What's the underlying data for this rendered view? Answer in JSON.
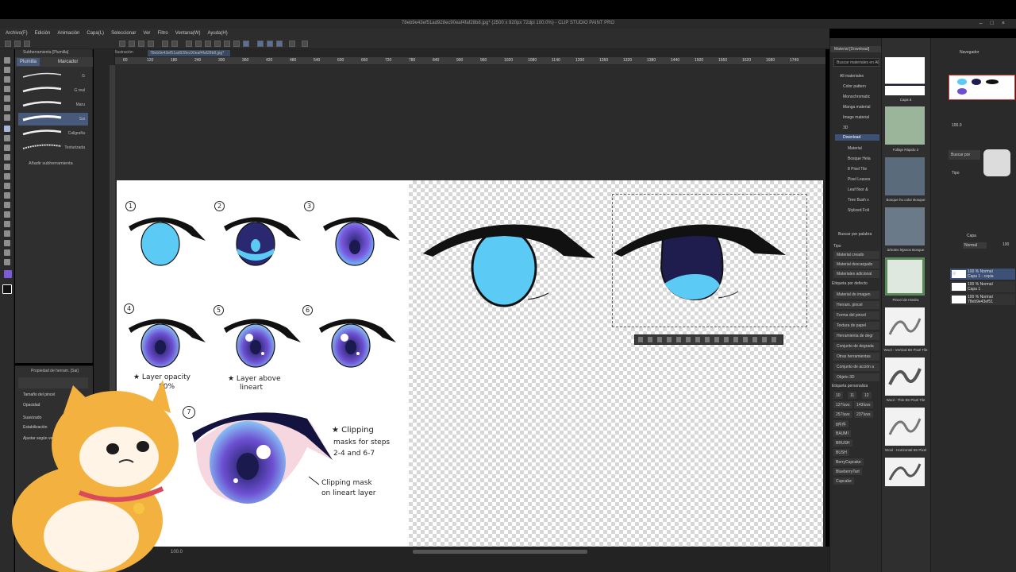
{
  "window": {
    "title": "78eb9e43ef51ad928ec90eaf4faf28b8.jpg* (2500 x 920px 72dpi 100.0%) - CLIP STUDIO PAINT PRO"
  },
  "menu": [
    "Archivo(F)",
    "Edición",
    "Animación",
    "Capa(L)",
    "Seleccionar",
    "Ver",
    "Filtro",
    "Ventana(W)",
    "Ayuda(H)"
  ],
  "canvas_tabs": {
    "left_label": "Ilustración",
    "file_tab": "78eb9e43ef51ad928ec90eaf4faf28b8.jpg*"
  },
  "ruler_ticks": [
    "60",
    "120",
    "180",
    "240",
    "300",
    "360",
    "420",
    "480",
    "540",
    "600",
    "660",
    "720",
    "780",
    "840",
    "900",
    "960",
    "1020",
    "1080",
    "1140",
    "1200",
    "1260",
    "1320",
    "1380",
    "1440",
    "1500",
    "1560",
    "1620",
    "1680",
    "1749"
  ],
  "subtool": {
    "header": "Subherramienta [Plumilla]",
    "tabs": [
      "Plumilla",
      "Marcador"
    ],
    "brushes": [
      "G",
      "G real",
      "Maru",
      "Sai",
      "Caligrafía",
      "Texturizada"
    ],
    "selected": "Sai",
    "add_label": "Añadir subherramienta"
  },
  "tool_property": {
    "header": "Propiedad de herram. [Sai]",
    "fields": [
      "Tamaño del pincel",
      "Opacidad",
      "Suavizado",
      "Estabilización",
      "Ajustar según vel."
    ]
  },
  "material_panel": {
    "header": "Material [Download]",
    "search_placeholder": "Buscar materiales en All",
    "tree": [
      "All materiales",
      "Color pattern",
      "Monochromatic",
      "Manga material",
      "Image material",
      "3D",
      "Download",
      "Material",
      "Bosque Hela",
      "8 Pixel Tile",
      "Pixel Leaves",
      "Leaf floor &",
      "Tree Bush s",
      "Stylized Foli"
    ],
    "selected_tree": "Download",
    "search_label": "Buscar por palabra",
    "type_label": "Tipo",
    "type_items": [
      "Material creado",
      "Material descargado",
      "Materiales adicional"
    ],
    "default_tag_label": "Etiqueta por defecto",
    "default_tags": [
      "Material de imagen",
      "Herram. pincel",
      "Forma del pincel",
      "Textura de papel",
      "Herramienta de degr",
      "Conjunto de degrada",
      "Otras herramientas",
      "Conjunto de acción a",
      "Objeto 3D"
    ],
    "custom_tag_label": "Etiqueta personaliza",
    "custom_tags": [
      "10",
      "11",
      "12",
      "127Iuvs",
      "143Iuvs",
      "257Iuvs",
      "237Iuvs",
      "8件件",
      "BAUMI",
      "BRUSH",
      "BUSH",
      "BerryCupcake",
      "BlueberryTart",
      "Cupcake"
    ]
  },
  "material_thumbs": [
    "Capa 6",
    "Follaje Rápido 2",
    "Bosque hu color Bosque",
    "árboles lejanos Bosque",
    "Pincel de Hiedra",
    "Wool - Vertical 8S Pixel Tile",
    "Wool - Thin 8S Pixel Tile",
    "Wool - Horizontal 8S Pixel"
  ],
  "right_panels": {
    "navigator_tab": "Navegador",
    "zoom": "100.0",
    "subview_label": "Buscar por",
    "subview_type": "Tipo",
    "layer_header": "Capa",
    "blend_mode": "Normal",
    "opacity": "100",
    "layers": [
      {
        "line1": "100 % Normal",
        "line2": "Capa 1 - copia"
      },
      {
        "line1": "100 % Normal",
        "line2": "Capa 1"
      },
      {
        "line1": "100 % Normal",
        "line2": "78eb9e43ef51"
      }
    ]
  },
  "artwork": {
    "step_numbers": [
      "1",
      "2",
      "3",
      "4",
      "5",
      "6",
      "7"
    ],
    "note_opacity_1": "★ Layer opacity",
    "note_opacity_2": "80%",
    "note_above_1": "★ Layer above",
    "note_above_2": "lineart",
    "note_clip_1": "★ Clipping",
    "note_clip_2": "masks for steps",
    "note_clip_3": "2-4 and 6-7",
    "note_clip_4": "Clipping mask",
    "note_clip_5": "on lineart layer"
  },
  "status": {
    "zoom": "100.0"
  },
  "colors": {
    "ui_bg": "#2b2b2b",
    "selection": "#485a7c",
    "eye_light_blue": "#5bcbf5",
    "eye_dark_navy": "#1f1d4d",
    "lash_black": "#111111"
  }
}
